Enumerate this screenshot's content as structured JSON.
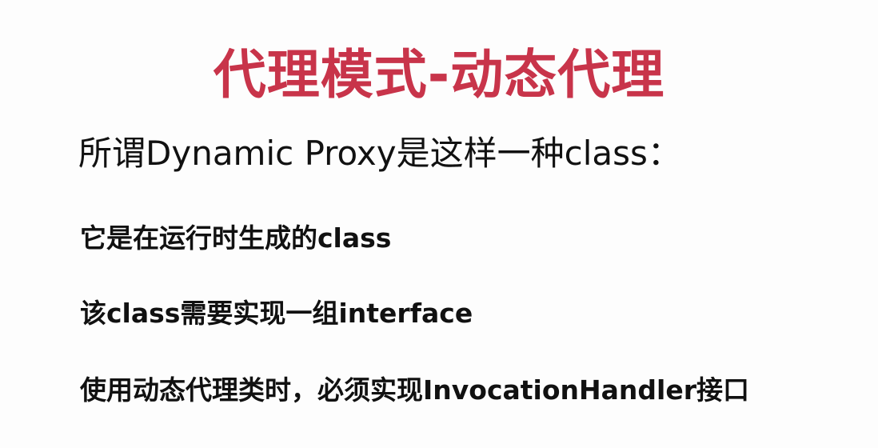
{
  "slide": {
    "title": "代理模式-动态代理",
    "subtitle": "所谓Dynamic Proxy是这样一种class：",
    "bullets": [
      "它是在运行时生成的class",
      "该class需要实现一组interface",
      "使用动态代理类时，必须实现InvocationHandler接口"
    ]
  },
  "colors": {
    "title": "#c8344a",
    "text": "#111111",
    "background": "#fdfdfd"
  }
}
